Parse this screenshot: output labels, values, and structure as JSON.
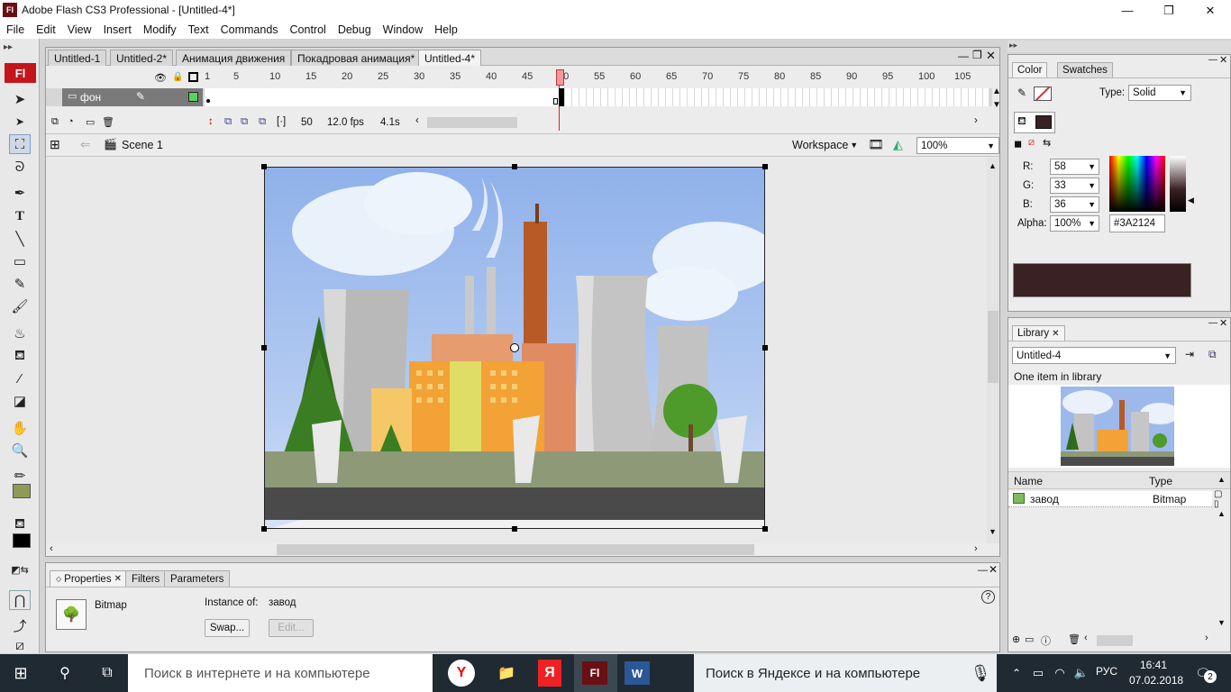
{
  "window": {
    "title": "Adobe Flash CS3 Professional - [Untitled-4*]",
    "logo": "Fl",
    "controls": [
      "—",
      "❐",
      "✕"
    ]
  },
  "menu": [
    "File",
    "Edit",
    "View",
    "Insert",
    "Modify",
    "Text",
    "Commands",
    "Control",
    "Debug",
    "Window",
    "Help"
  ],
  "tools": {
    "logo": "Fl",
    "icons": [
      "selection-icon",
      "subselection-icon",
      "free-transform-icon",
      "lasso-icon",
      "pen-icon",
      "text-icon",
      "line-icon",
      "rectangle-icon",
      "pencil-icon",
      "brush-icon",
      "ink-bottle-icon",
      "paint-bucket-icon",
      "eyedropper-icon",
      "eraser-icon",
      "hand-icon",
      "zoom-icon"
    ]
  },
  "documents": {
    "tabs": [
      "Untitled-1",
      "Untitled-2*",
      "Анимация движения",
      "Покадровая анимация*",
      "Untitled-4*"
    ],
    "active": 4
  },
  "timeline": {
    "ruler": [
      "1",
      "5",
      "10",
      "15",
      "20",
      "25",
      "30",
      "35",
      "40",
      "45",
      "50",
      "55",
      "60",
      "65",
      "70",
      "75",
      "80",
      "85",
      "90",
      "95",
      "100",
      "105"
    ],
    "layer_name": "фон",
    "current_frame": "50",
    "fps": "12.0 fps",
    "time": "4.1s"
  },
  "scene": {
    "name": "Scene 1",
    "workspace_label": "Workspace",
    "zoom": "100%"
  },
  "properties": {
    "tabs": [
      "Properties",
      "Filters",
      "Parameters"
    ],
    "type_label": "Bitmap",
    "instance_label": "Instance of:",
    "instance_value": "завод",
    "swap_button": "Swap...",
    "edit_button": "Edit..."
  },
  "color_panel": {
    "tabs": [
      "Color",
      "Swatches"
    ],
    "type_label": "Type:",
    "type_value": "Solid",
    "r_label": "R:",
    "r": "58",
    "g_label": "G:",
    "g": "33",
    "b_label": "B:",
    "b": "36",
    "alpha_label": "Alpha:",
    "alpha": "100%",
    "hex": "#3A2124",
    "swatch_color": "#3A2124"
  },
  "library": {
    "tab": "Library",
    "doc_select": "Untitled-4",
    "count_text": "One item in library",
    "col_name": "Name",
    "col_type": "Type",
    "items": [
      {
        "name": "завод",
        "type": "Bitmap"
      }
    ]
  },
  "taskbar": {
    "search_placeholder": "Поиск в интернете и на компьютере",
    "yandex_search": "Поиск в Яндексе и на компьютере",
    "language": "РУС",
    "time": "16:41",
    "date": "07.02.2018",
    "notifications": "2"
  }
}
